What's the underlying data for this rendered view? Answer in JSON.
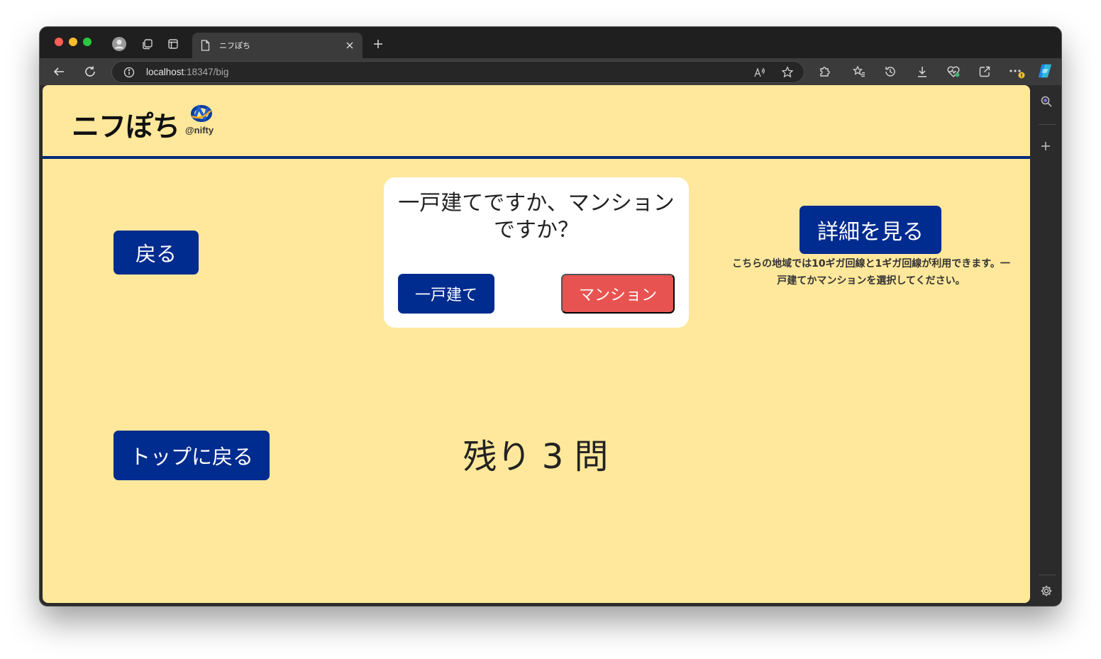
{
  "browser": {
    "tab_title": "ニフぽち",
    "url_host": "localhost",
    "url_rest": ":18347/big"
  },
  "icons": [
    "back-arrow-icon",
    "reload-icon",
    "info-icon",
    "read-aloud-icon",
    "favorite-star-icon",
    "extensions-icon",
    "favorites-icon",
    "history-icon",
    "download-icon",
    "performance-icon",
    "share-icon",
    "more-icon",
    "copilot-icon",
    "search-icon",
    "plus-icon",
    "settings-icon",
    "profile-icon",
    "collections-icon",
    "tab-actions-icon",
    "page-icon",
    "close-icon"
  ],
  "header": {
    "logo_text": "ニフぽち",
    "logo_sub": "@nifty"
  },
  "nav": {
    "back_label": "戻る",
    "top_label": "トップに戻る",
    "detail_label": "詳細を見る"
  },
  "question": {
    "text": "一戸建てですか、マンションですか？",
    "option_house": "一戸建て",
    "option_mansion": "マンション"
  },
  "note": "こちらの地域では10ギガ回線と1ギガ回線が利用できます。一戸建てかマンションを選択してください。",
  "remaining": "残り 3 問",
  "colors": {
    "background": "#ffe89b",
    "primary": "#002b8f",
    "danger": "#e75350",
    "header_line": "#00287a"
  }
}
